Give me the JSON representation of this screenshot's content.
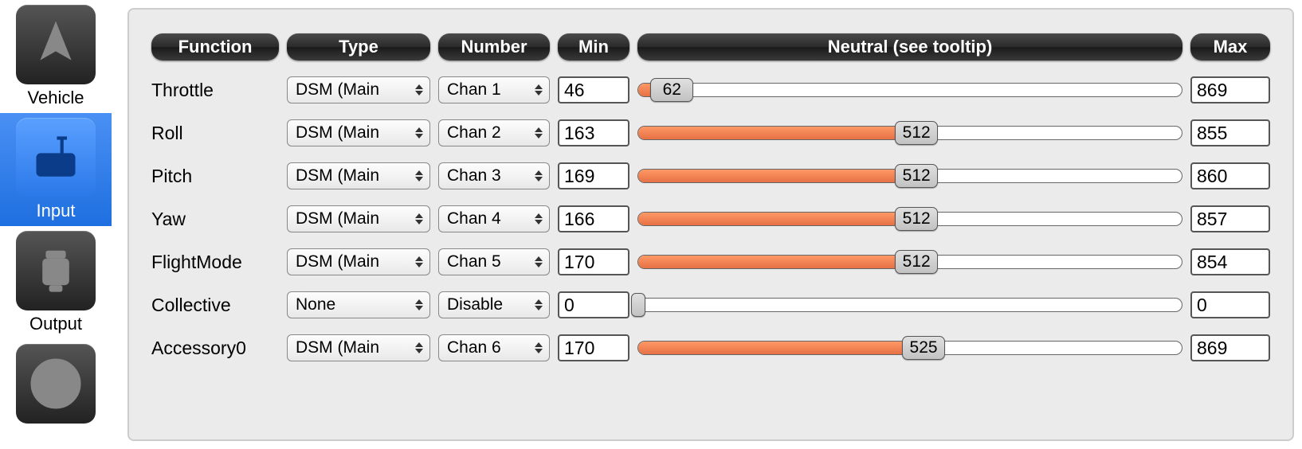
{
  "sidebar": {
    "items": [
      {
        "label": "Vehicle",
        "icon": "aircraft-icon",
        "selected": false
      },
      {
        "label": "Input",
        "icon": "transmitter-icon",
        "selected": true
      },
      {
        "label": "Output",
        "icon": "motor-icon",
        "selected": false
      },
      {
        "label": "",
        "icon": "attitude-icon",
        "selected": false
      }
    ]
  },
  "headers": {
    "function": "Function",
    "type": "Type",
    "number": "Number",
    "min": "Min",
    "neutral": "Neutral (see tooltip)",
    "max": "Max"
  },
  "slider": {
    "scale_max": 1000
  },
  "rows": [
    {
      "function": "Throttle",
      "type": "DSM (Main",
      "number": "Chan 1",
      "min": "46",
      "neutral": 62,
      "max": "869",
      "fill": true,
      "thumb_has_label": true
    },
    {
      "function": "Roll",
      "type": "DSM (Main",
      "number": "Chan 2",
      "min": "163",
      "neutral": 512,
      "max": "855",
      "fill": true,
      "thumb_has_label": true
    },
    {
      "function": "Pitch",
      "type": "DSM (Main",
      "number": "Chan 3",
      "min": "169",
      "neutral": 512,
      "max": "860",
      "fill": true,
      "thumb_has_label": true
    },
    {
      "function": "Yaw",
      "type": "DSM (Main",
      "number": "Chan 4",
      "min": "166",
      "neutral": 512,
      "max": "857",
      "fill": true,
      "thumb_has_label": true
    },
    {
      "function": "FlightMode",
      "type": "DSM (Main",
      "number": "Chan 5",
      "min": "170",
      "neutral": 512,
      "max": "854",
      "fill": true,
      "thumb_has_label": true
    },
    {
      "function": "Collective",
      "type": "None",
      "number": "Disable",
      "min": "0",
      "neutral": 0,
      "max": "0",
      "fill": false,
      "thumb_has_label": false
    },
    {
      "function": "Accessory0",
      "type": "DSM (Main",
      "number": "Chan 6",
      "min": "170",
      "neutral": 525,
      "max": "869",
      "fill": true,
      "thumb_has_label": true
    }
  ]
}
